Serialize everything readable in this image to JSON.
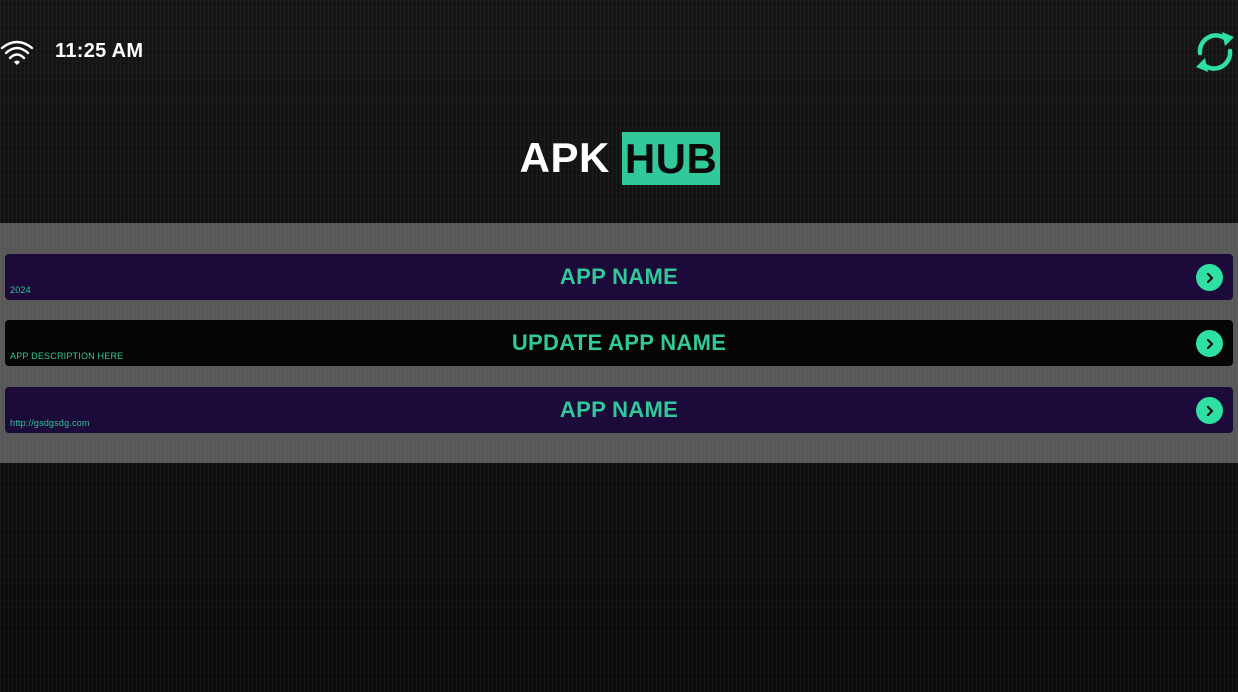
{
  "colors": {
    "accent": "#31c89a",
    "arrow_bg": "#2ee0a2",
    "row_purple": "#1b0a3a",
    "row_black": "#050505",
    "panel_bg": "#585858"
  },
  "status_bar": {
    "wifi_icon": "wifi-icon",
    "time": "11:25 AM",
    "refresh_icon": "refresh-icon"
  },
  "logo": {
    "part1": "APK",
    "part2": "HUB"
  },
  "apps": [
    {
      "title": "APP NAME",
      "subtitle": "2024",
      "style": "purple"
    },
    {
      "title": "UPDATE APP NAME",
      "subtitle": "APP DESCRIPTION HERE",
      "style": "black"
    },
    {
      "title": "APP NAME",
      "subtitle": "http://gsdgsdg.com",
      "style": "purple"
    }
  ]
}
